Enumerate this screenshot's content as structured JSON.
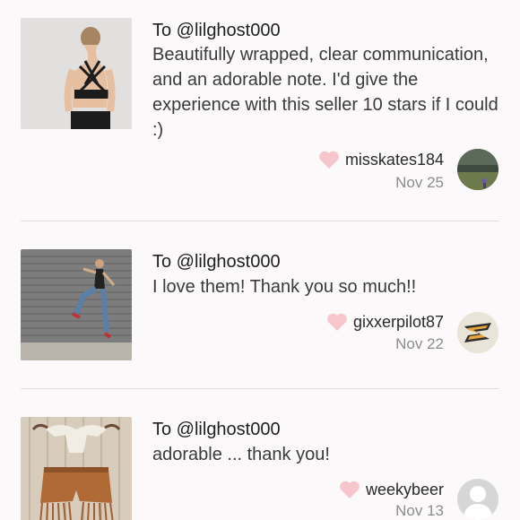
{
  "reviews": [
    {
      "to": "To @lilghost000",
      "message": "Beautifully wrapped, clear communication, and an adorable note. I'd give the experience with this seller 10 stars if I could :)",
      "username": "misskates184",
      "date": "Nov 25",
      "thumb_icon": "product-photo-sports-bra",
      "avatar_icon": "user-avatar-landscape"
    },
    {
      "to": "To @lilghost000",
      "message": "I love them! Thank you so much!!",
      "username": "gixxerpilot87",
      "date": "Nov 22",
      "thumb_icon": "product-photo-leggings",
      "avatar_icon": "user-avatar-logo"
    },
    {
      "to": "To @lilghost000",
      "message": "adorable ... thank you!",
      "username": "weekybeer",
      "date": "Nov 13",
      "thumb_icon": "product-photo-fringe-shorts",
      "avatar_icon": "user-avatar-default"
    }
  ],
  "colors": {
    "heart": "#f7c5cc",
    "divider": "#dedede",
    "date": "#8c8c8c",
    "background": "#fbf9f9"
  }
}
